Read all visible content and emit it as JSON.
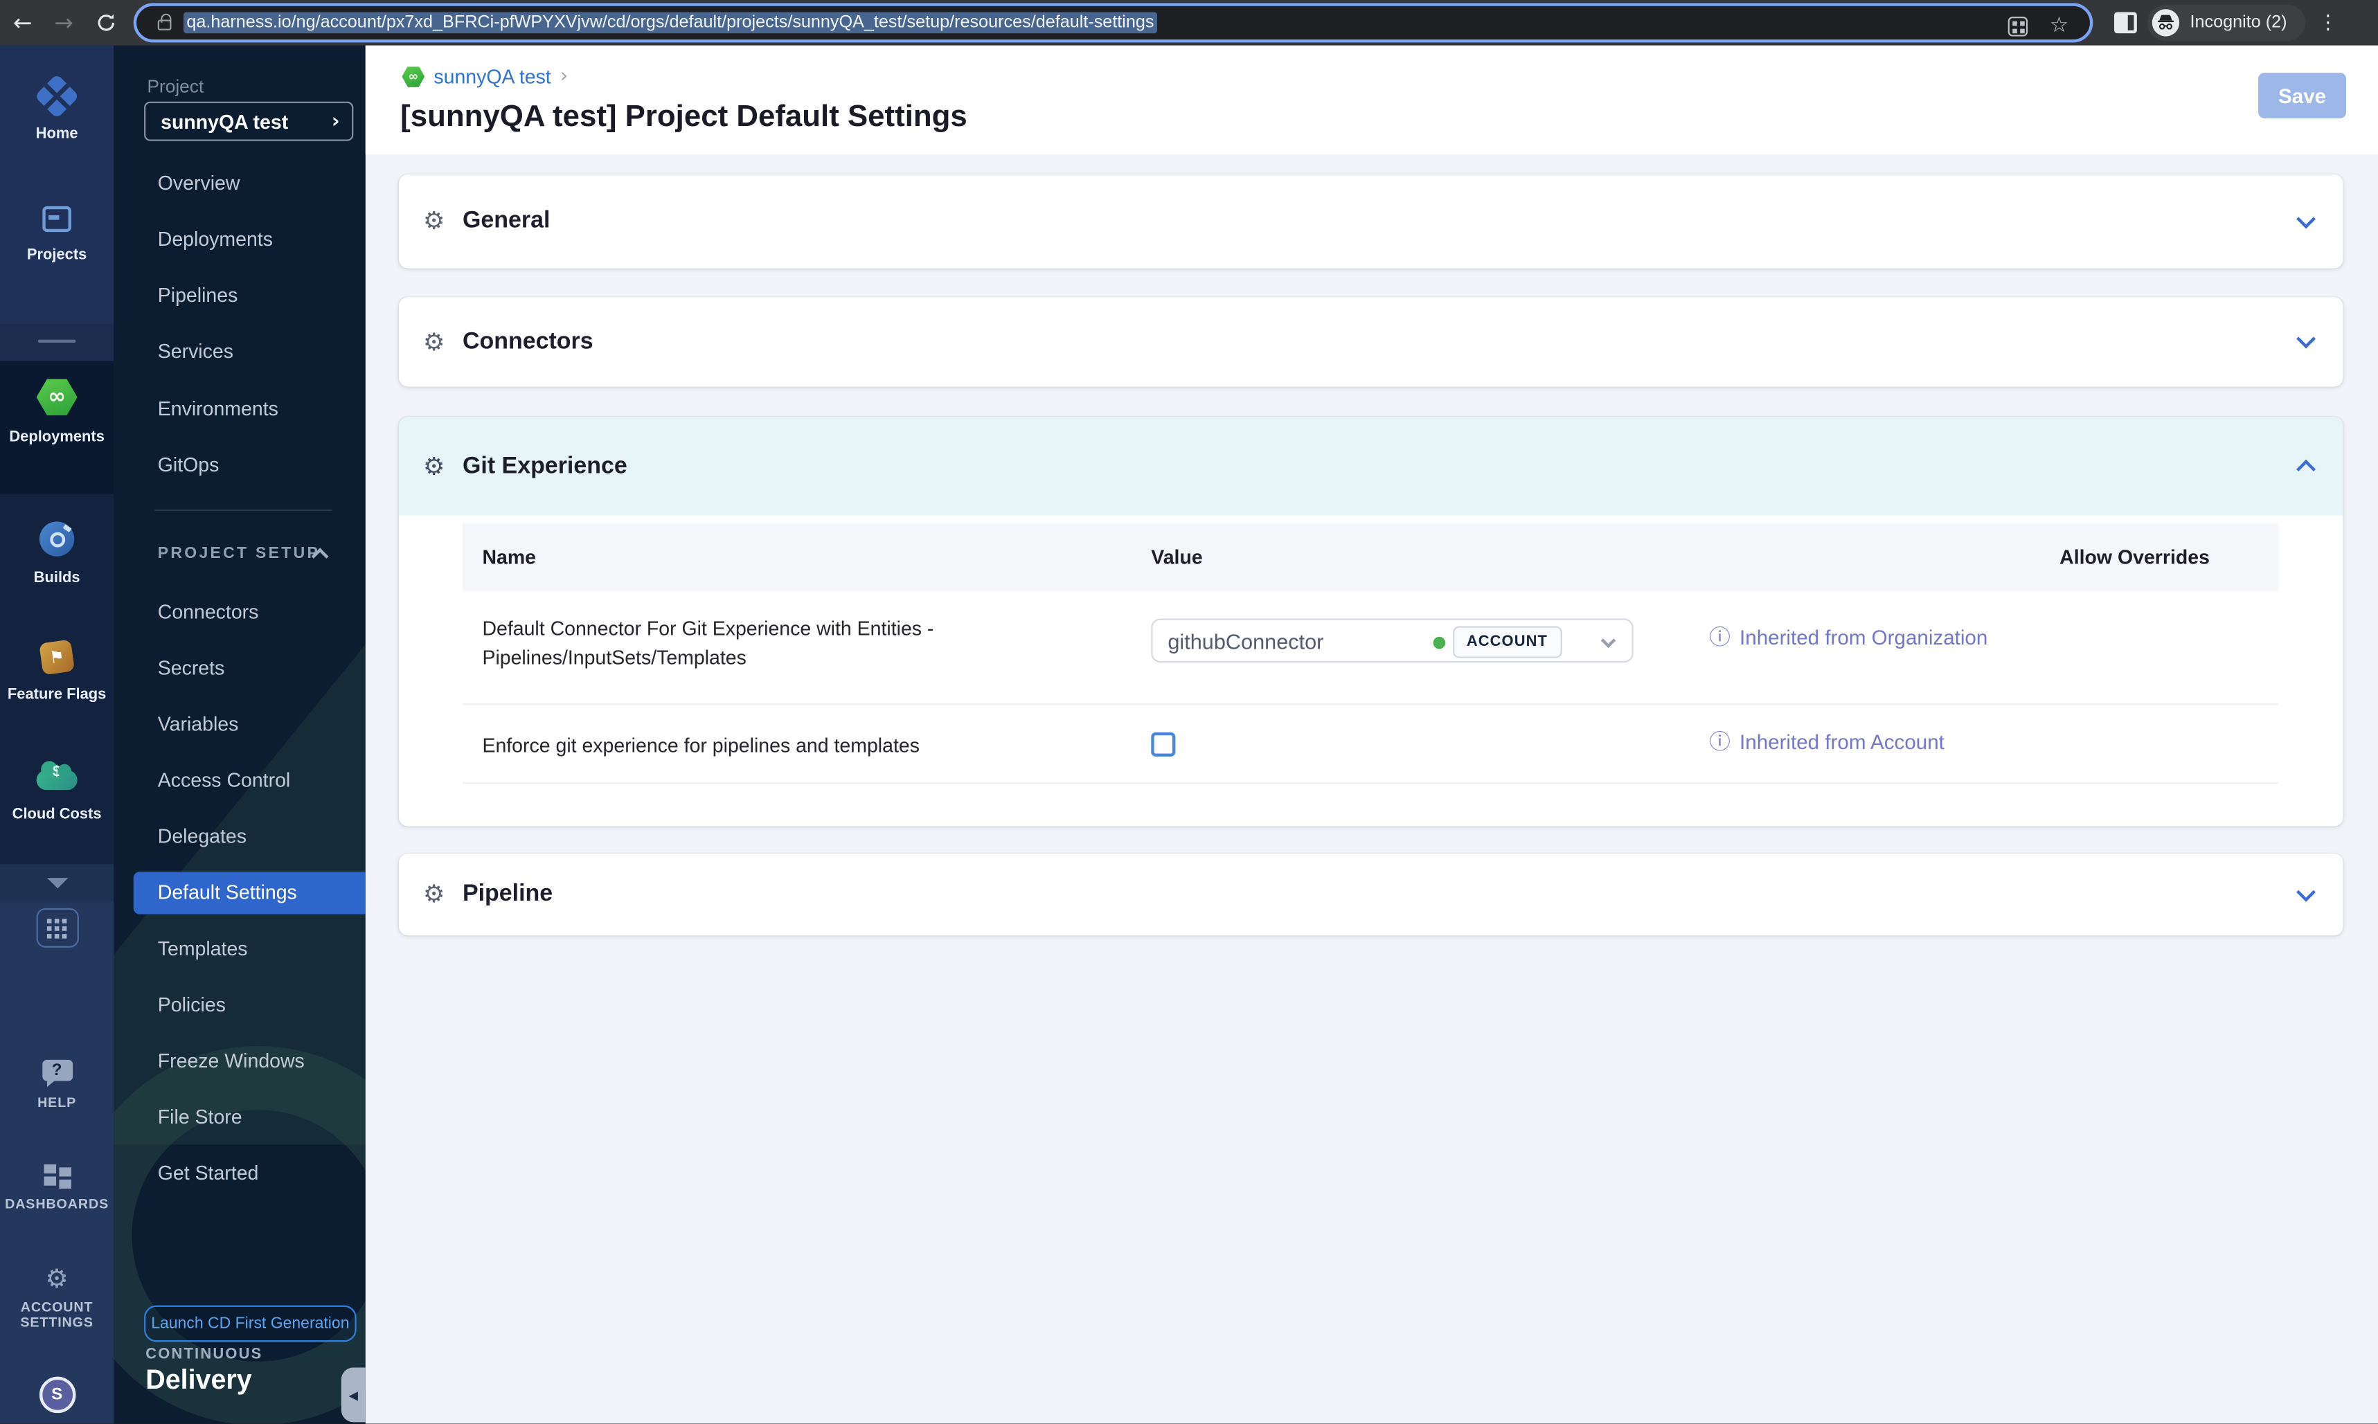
{
  "browser": {
    "url": "qa.harness.io/ng/account/px7xd_BFRCi-pfWPYXVjvw/cd/orgs/default/projects/sunnyQA_test/setup/resources/default-settings",
    "incognito_label": "Incognito (2)"
  },
  "icons": {
    "back_arrow": "←",
    "forward_arrow": "→",
    "refresh": "⟳",
    "star": "☆",
    "kebab": "⋮",
    "gear": "⚙",
    "infinity": "∞",
    "flag": "⚑",
    "dollar": "$",
    "question": "?",
    "chevron_right": "›",
    "info_circle": "ⓘ",
    "collapse_left": "◀"
  },
  "colors": {
    "accent_blue": "#2f66cb",
    "link_blue": "#3072cc",
    "note_purple": "#7377c9",
    "deploy_green": "#3fbf4d",
    "git_header_bg": "#e7f5f9",
    "save_disabled": "#9db7e8"
  },
  "sidebar1": {
    "items": [
      {
        "label": "Home"
      },
      {
        "label": "Projects"
      },
      {
        "label": "Deployments"
      },
      {
        "label": "Builds"
      },
      {
        "label": "Feature Flags"
      },
      {
        "label": "Cloud Costs"
      },
      {
        "label": "HELP"
      },
      {
        "label": "DASHBOARDS"
      },
      {
        "label": "ACCOUNT"
      },
      {
        "label": "SETTINGS"
      }
    ],
    "active_item": "Deployments",
    "avatar_initial": "S"
  },
  "sidebar2": {
    "project_label": "Project",
    "project_name": "sunnyQA test",
    "nav": [
      "Overview",
      "Deployments",
      "Pipelines",
      "Services",
      "Environments",
      "GitOps"
    ],
    "setup_label": "PROJECT SETUP",
    "setup_nav": [
      "Connectors",
      "Secrets",
      "Variables",
      "Access Control",
      "Delegates",
      "Default Settings",
      "Templates",
      "Policies",
      "Freeze Windows",
      "File Store",
      "Get Started"
    ],
    "active_item": "Default Settings",
    "launch_button": "Launch CD First Generation",
    "footer_top": "CONTINUOUS",
    "footer_bottom": "Delivery"
  },
  "header": {
    "breadcrumb": "sunnyQA test",
    "title": "[sunnyQA test] Project Default Settings",
    "save_label": "Save"
  },
  "sections": {
    "general": "General",
    "connectors": "Connectors",
    "git_experience": "Git Experience",
    "pipeline": "Pipeline"
  },
  "git_table": {
    "headers": {
      "name": "Name",
      "value": "Value",
      "allow_overrides": "Allow Overrides"
    },
    "rows": [
      {
        "name": "Default Connector For Git Experience with Entities - Pipelines/InputSets/Templates",
        "value": "githubConnector",
        "scope": "ACCOUNT",
        "note": "Inherited from Organization"
      },
      {
        "name": "Enforce git experience for pipelines and templates",
        "checkbox_checked": false,
        "note": "Inherited from Account"
      }
    ]
  }
}
